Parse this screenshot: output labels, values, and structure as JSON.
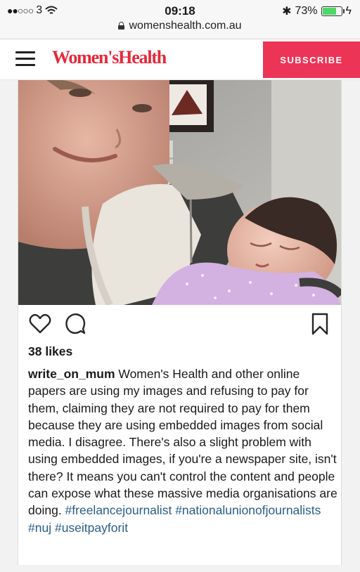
{
  "status": {
    "signal": "●●○○○",
    "carrier": "3",
    "time": "09:18",
    "bluetooth": "✱",
    "battery_percent": "73%",
    "battery_level": 0.73,
    "charging": "ϟ",
    "url": "womenshealth.com.au"
  },
  "header": {
    "brand": "Women'sHealth",
    "subscribe_label": "SUBSCRIBE"
  },
  "colors": {
    "brand": "#e5293b",
    "subscribe_bg": "#ec3456",
    "hashtag": "#2a5d8a"
  },
  "post": {
    "icons": [
      "heart-icon",
      "comment-icon",
      "bookmark-icon"
    ],
    "likes": "38 likes",
    "username": "write_on_mum",
    "caption": " Women's Health and other online papers are using my images and refusing to pay for them, claiming they are not required to pay for them because they are using embedded images from social media. I disagree. There's also a slight problem with using embedded images, if you're a newspaper site, isn't there? It means you can't control the content and people can expose what these massive media organisations are doing. ",
    "hashtags": [
      "#freelancejournalist",
      "#nationalunionofjournalists",
      "#nuj",
      "#useitpayforit"
    ]
  }
}
